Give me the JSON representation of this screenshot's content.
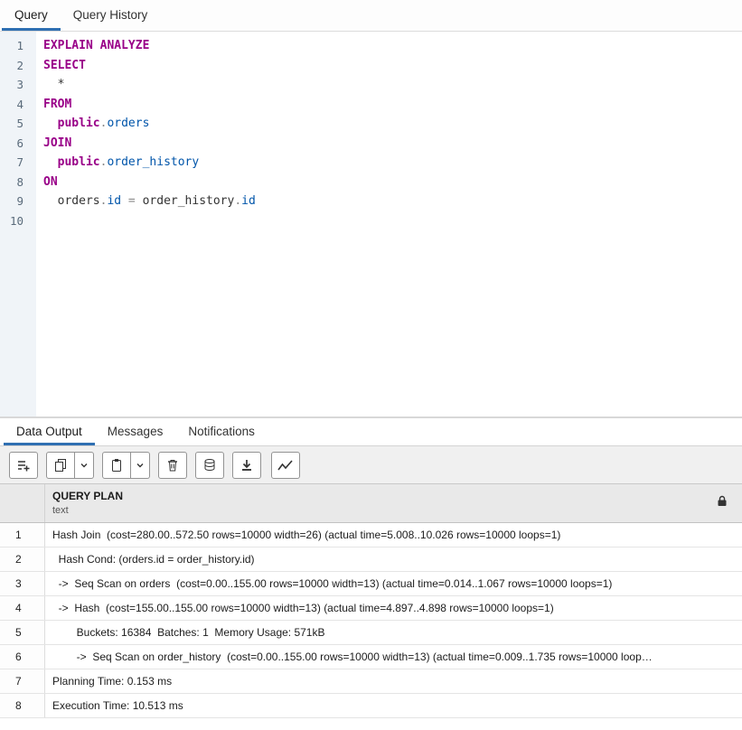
{
  "top_tabs": [
    {
      "label": "Query",
      "active": true
    },
    {
      "label": "Query History",
      "active": false
    }
  ],
  "editor": {
    "lines": [
      {
        "n": "1",
        "tokens": [
          [
            "kw",
            "EXPLAIN ANALYZE"
          ]
        ]
      },
      {
        "n": "2",
        "tokens": [
          [
            "kw",
            "SELECT"
          ]
        ]
      },
      {
        "n": "3",
        "tokens": [
          [
            "pl",
            "  *"
          ]
        ]
      },
      {
        "n": "4",
        "tokens": [
          [
            "kw",
            "FROM"
          ]
        ]
      },
      {
        "n": "5",
        "tokens": [
          [
            "pl",
            "  "
          ],
          [
            "kw",
            "public"
          ],
          [
            "op",
            "."
          ],
          [
            "id",
            "orders"
          ]
        ]
      },
      {
        "n": "6",
        "tokens": [
          [
            "kw",
            "JOIN"
          ]
        ]
      },
      {
        "n": "7",
        "tokens": [
          [
            "pl",
            "  "
          ],
          [
            "kw",
            "public"
          ],
          [
            "op",
            "."
          ],
          [
            "id",
            "order_history"
          ]
        ]
      },
      {
        "n": "8",
        "tokens": [
          [
            "kw",
            "ON"
          ]
        ]
      },
      {
        "n": "9",
        "tokens": [
          [
            "pl",
            "  orders"
          ],
          [
            "op",
            "."
          ],
          [
            "id",
            "id"
          ],
          [
            "op",
            " = "
          ],
          [
            "pl",
            "order_history"
          ],
          [
            "op",
            "."
          ],
          [
            "id",
            "id"
          ]
        ]
      },
      {
        "n": "10",
        "tokens": []
      }
    ]
  },
  "bottom_tabs": [
    {
      "label": "Data Output",
      "active": true
    },
    {
      "label": "Messages",
      "active": false
    },
    {
      "label": "Notifications",
      "active": false
    }
  ],
  "toolbar": {
    "buttons": [
      "add-row",
      "copy",
      "copy-options-dropdown",
      "paste",
      "paste-options-dropdown",
      "delete-row",
      "save-data-changes",
      "save-results-to-file",
      "graph-visualiser"
    ]
  },
  "grid": {
    "column": {
      "name": "QUERY PLAN",
      "type": "text",
      "readonly_icon": "lock-icon"
    },
    "rows": [
      {
        "num": "1",
        "text": "Hash Join  (cost=280.00..572.50 rows=10000 width=26) (actual time=5.008..10.026 rows=10000 loops=1)"
      },
      {
        "num": "2",
        "text": "  Hash Cond: (orders.id = order_history.id)"
      },
      {
        "num": "3",
        "text": "  ->  Seq Scan on orders  (cost=0.00..155.00 rows=10000 width=13) (actual time=0.014..1.067 rows=10000 loops=1)"
      },
      {
        "num": "4",
        "text": "  ->  Hash  (cost=155.00..155.00 rows=10000 width=13) (actual time=4.897..4.898 rows=10000 loops=1)"
      },
      {
        "num": "5",
        "text": "        Buckets: 16384  Batches: 1  Memory Usage: 571kB"
      },
      {
        "num": "6",
        "text": "        ->  Seq Scan on order_history  (cost=0.00..155.00 rows=10000 width=13) (actual time=0.009..1.735 rows=10000 loop…"
      },
      {
        "num": "7",
        "text": "Planning Time: 0.153 ms"
      },
      {
        "num": "8",
        "text": "Execution Time: 10.513 ms"
      }
    ]
  },
  "colors": {
    "accent_tab_underline": "#2f6fb2",
    "sql_keyword": "#990088",
    "sql_identifier": "#0055aa",
    "gutter_background": "#f0f4f8",
    "header_background": "#e9e9e9"
  }
}
